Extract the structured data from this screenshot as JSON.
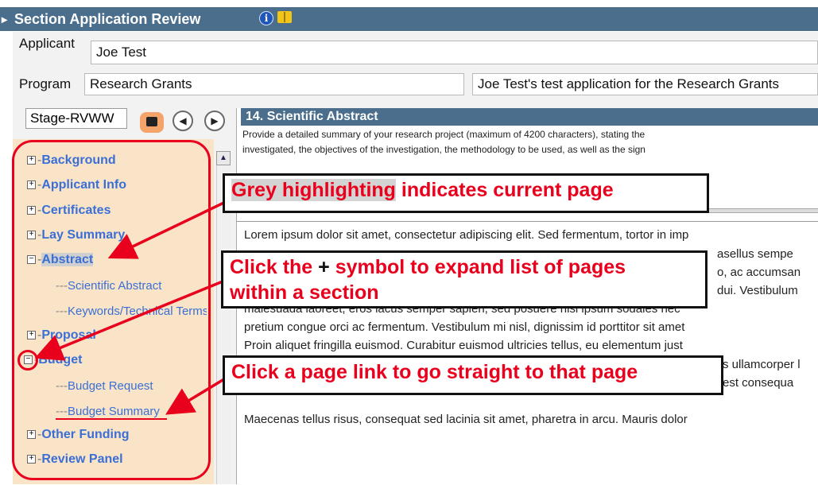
{
  "window": {
    "title": "Section Application Review"
  },
  "applicant": {
    "label": "Applicant",
    "value": "Joe Test"
  },
  "program": {
    "label": "Program",
    "value": "Research Grants",
    "description": "Joe Test's test application for the Research Grants"
  },
  "toolbar": {
    "stage_value": "Stage-RVWW"
  },
  "nav": {
    "items": [
      {
        "label": "Background",
        "expanded": false
      },
      {
        "label": "Applicant Info",
        "expanded": false
      },
      {
        "label": "Certificates",
        "expanded": false
      },
      {
        "label": "Lay Summary",
        "expanded": false
      },
      {
        "label": "Abstract",
        "expanded": true,
        "current": true
      },
      {
        "label": "Scientific Abstract"
      },
      {
        "label": "Keywords/Technical Terms"
      },
      {
        "label": "Proposal",
        "expanded": false
      },
      {
        "label": "Budget",
        "expanded": true
      },
      {
        "label": "Budget Request"
      },
      {
        "label": "Budget Summary"
      },
      {
        "label": "Other Funding",
        "expanded": false
      },
      {
        "label": "Review Panel",
        "expanded": false
      }
    ]
  },
  "section": {
    "title": "14. Scientific Abstract",
    "description_lines": [
      "Provide a detailed summary of your research project (maximum of 4200 characters), stating the",
      "investigated, the objectives of the investigation, the methodology to be used, as well as the sign"
    ],
    "body_lines": [
      "Lorem ipsum dolor sit amet, consectetur adipiscing elit. Sed fermentum, tortor in imp",
      "asellus sempe",
      "o, ac accumsan",
      "dui. Vestibulum",
      "malesuada laoreet, eros lacus semper sapien, sed posuere nisi ipsum sodales nec",
      "pretium congue orci ac fermentum. Vestibulum mi nisl, dignissim id porttitor sit amet",
      "Proin aliquet fringilla euismod. Curabitur euismod ultricies tellus, eu elementum just",
      "s ullamcorper l",
      "est consequa",
      "Maecenas tellus risus, consequat sed lacinia sit amet, pharetra in arcu. Mauris dolor"
    ]
  },
  "callouts": {
    "grey": {
      "highlight": "Grey highlighting",
      "rest": " indicates current page"
    },
    "plus": {
      "part1": "Click the ",
      "symbol": "+",
      "part2": " symbol to expand list of pages",
      "line2": "within a section"
    },
    "link": {
      "text": "Click a page link to go straight to that page"
    }
  }
}
